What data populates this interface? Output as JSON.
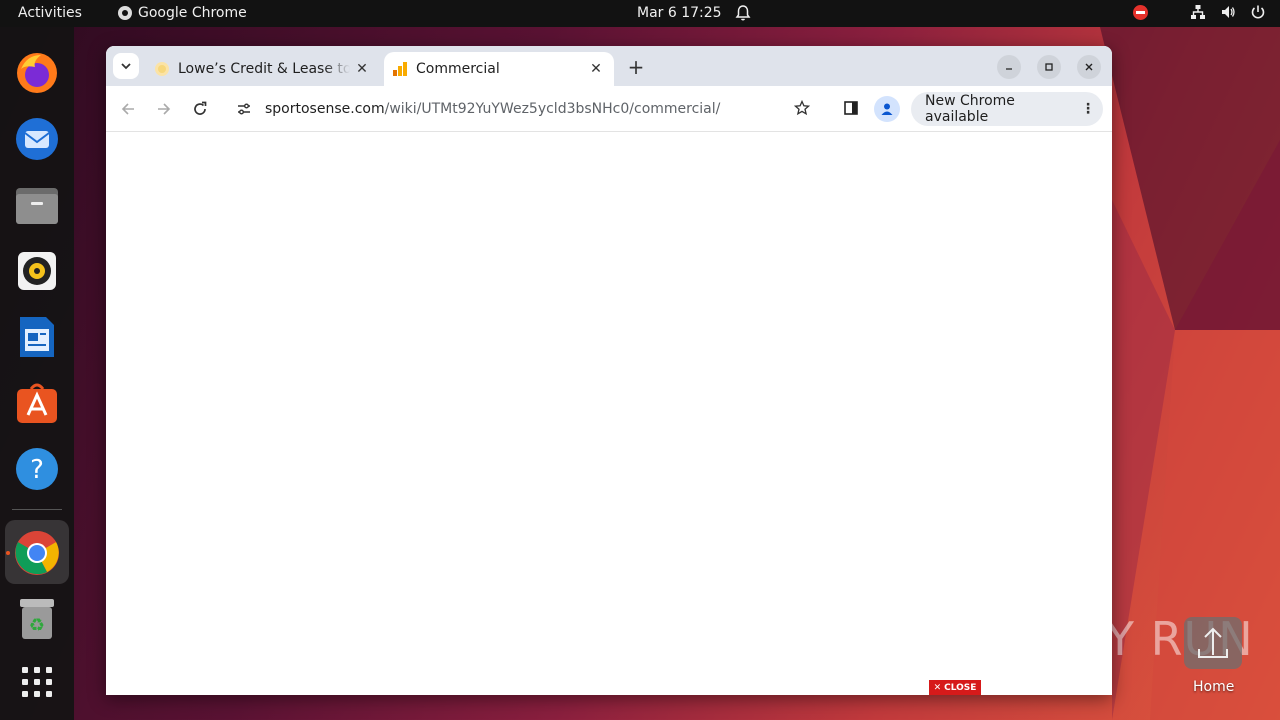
{
  "topbar": {
    "activities": "Activities",
    "app_name": "Google Chrome",
    "clock": "Mar 6  17:25"
  },
  "dock": {
    "apps": [
      "firefox-icon",
      "thunderbird-icon",
      "files-icon",
      "rhythmbox-icon",
      "libreoffice-writer-icon",
      "app-center-icon",
      "help-icon",
      "chrome-icon",
      "trash-icon",
      "show-apps-icon"
    ],
    "active_app": "chrome-icon"
  },
  "browser": {
    "tabs": [
      {
        "title": "Lowe’s Credit & Lease to",
        "active": false
      },
      {
        "title": "Commercial",
        "active": true
      }
    ],
    "url_domain": "sportosense.com",
    "url_path": "/wiki/UTMt92YuYWez5ycld3bsNHc0/commercial/",
    "update_chip": "New Chrome available"
  },
  "page": {
    "close_badge": "CLOSE"
  },
  "desktop": {
    "home_label": "Home",
    "watermark": "ANY RUN"
  },
  "colors": {
    "accent_orange": "#e95420",
    "close_red": "#d61a1a",
    "tabstrip": "#dfe3eb"
  }
}
